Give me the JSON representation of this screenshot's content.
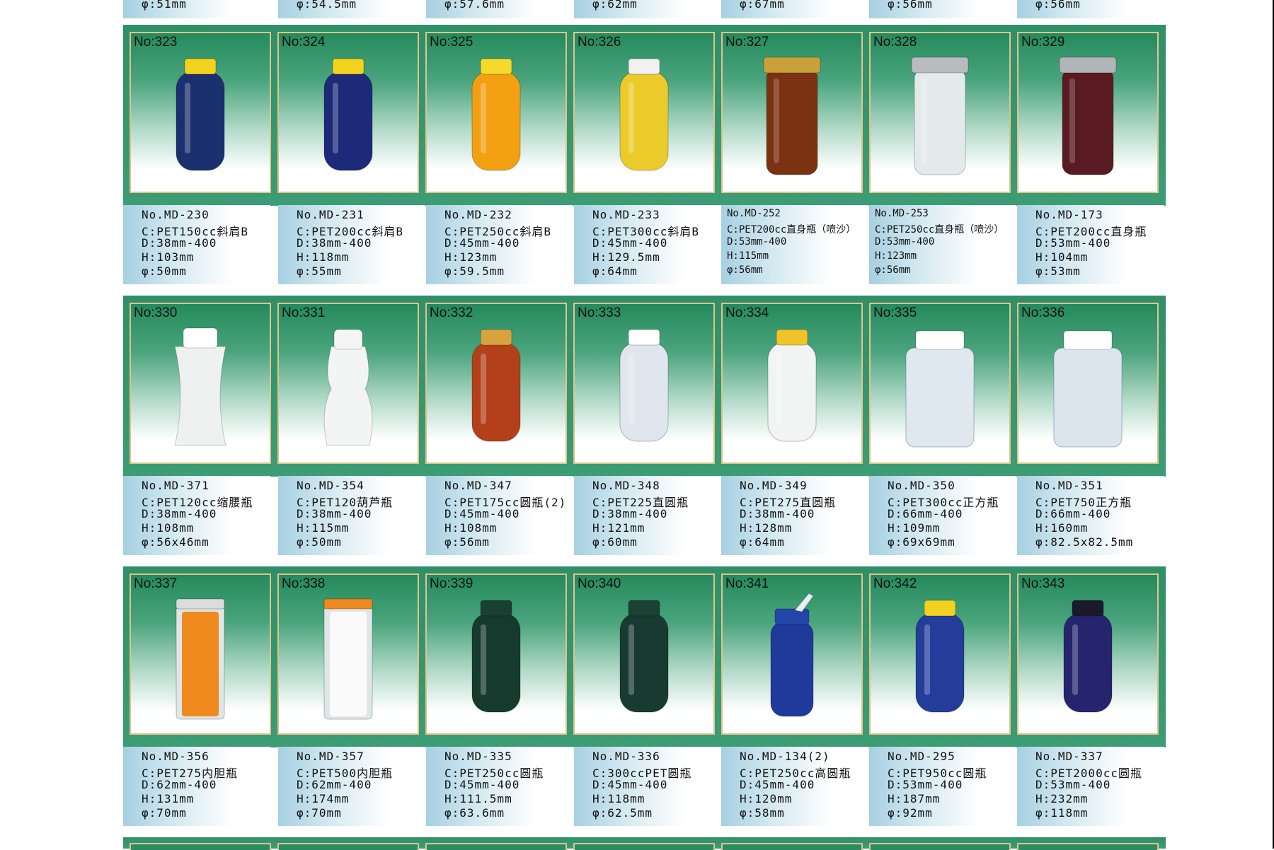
{
  "top_strip": [
    "φ:51mm",
    "φ:54.5mm",
    "φ:57.6mm",
    "φ:62mm",
    "φ:67mm",
    "φ:56mm",
    "φ:56mm"
  ],
  "rows": [
    [
      {
        "no": "No:323",
        "code": "No.MD-230",
        "c": "C:PET150cc斜肩B",
        "d": "D:38mm-400",
        "h": "H:103mm",
        "phi": "φ:50mm",
        "bottle": {
          "body": "#1c2f6e",
          "cap": "#f2d21e",
          "shape": "round"
        }
      },
      {
        "no": "No:324",
        "code": "No.MD-231",
        "c": "C:PET200cc斜肩B",
        "d": "D:38mm-400",
        "h": "H:118mm",
        "phi": "φ:55mm",
        "bottle": {
          "body": "#1d2a7a",
          "cap": "#f2d21e",
          "shape": "round"
        }
      },
      {
        "no": "No:325",
        "code": "No.MD-232",
        "c": "C:PET250cc斜肩B",
        "d": "D:45mm-400",
        "h": "H:123mm",
        "phi": "φ:59.5mm",
        "bottle": {
          "body": "#f2a012",
          "cap": "#f5d92c",
          "shape": "round"
        }
      },
      {
        "no": "No:326",
        "code": "No.MD-233",
        "c": "C:PET300cc斜肩B",
        "d": "D:45mm-400",
        "h": "H:129.5mm",
        "phi": "φ:64mm",
        "bottle": {
          "body": "#eacb2a",
          "cap": "#f1f1f1",
          "shape": "round"
        }
      },
      {
        "no": "No:327",
        "code": "No.MD-252",
        "c": "C:PET200cc直身瓶（喷沙）",
        "d": "D:53mm-400",
        "h": "H:115mm",
        "phi": "φ:56mm",
        "bottle": {
          "body": "#7a3212",
          "cap": "#c9a13a",
          "shape": "straight"
        }
      },
      {
        "no": "No:328",
        "code": "No.MD-253",
        "c": "C:PET250cc直身瓶（喷沙）",
        "d": "D:53mm-400",
        "h": "H:123mm",
        "phi": "φ:56mm",
        "bottle": {
          "body": "#e3ebea",
          "cap": "#b9bcbf",
          "shape": "straight"
        }
      },
      {
        "no": "No:329",
        "code": "No.MD-173",
        "c": "C:PET200cc直身瓶",
        "d": "D:53mm-400",
        "h": "H:104mm",
        "phi": "φ:53mm",
        "bottle": {
          "body": "#5a1a22",
          "cap": "#b1b5b8",
          "shape": "straight"
        }
      }
    ],
    [
      {
        "no": "No:330",
        "code": "No.MD-371",
        "c": "C:PET120cc缩腰瓶",
        "d": "D:38mm-400",
        "h": "H:108mm",
        "phi": "φ:56x46mm",
        "bottle": {
          "body": "#eef1f0",
          "cap": "#ffffff",
          "shape": "waist"
        }
      },
      {
        "no": "No:331",
        "code": "No.MD-354",
        "c": "C:PET120葫芦瓶",
        "d": "D:38mm-400",
        "h": "H:115mm",
        "phi": "φ:50mm",
        "bottle": {
          "body": "#f3f4f4",
          "cap": "#f5f5f5",
          "shape": "gourd"
        }
      },
      {
        "no": "No:332",
        "code": "No.MD-347",
        "c": "C:PET175cc圆瓶(2)",
        "d": "D:45mm-400",
        "h": "H:108mm",
        "phi": "φ:56mm",
        "bottle": {
          "body": "#b3401a",
          "cap": "#d6a33e",
          "shape": "round"
        }
      },
      {
        "no": "No:333",
        "code": "No.MD-348",
        "c": "C:PET225直圆瓶",
        "d": "D:38mm-400",
        "h": "H:121mm",
        "phi": "φ:60mm",
        "bottle": {
          "body": "#dfe6ee",
          "cap": "#ffffff",
          "shape": "round"
        }
      },
      {
        "no": "No:334",
        "code": "No.MD-349",
        "c": "C:PET275直圆瓶",
        "d": "D:38mm-400",
        "h": "H:128mm",
        "phi": "φ:64mm",
        "bottle": {
          "body": "#f2f3f3",
          "cap": "#f2c22a",
          "shape": "round"
        }
      },
      {
        "no": "No:335",
        "code": "No.MD-350",
        "c": "C:PET300cc正方瓶",
        "d": "D:66mm-400",
        "h": "H:109mm",
        "phi": "φ:69x69mm",
        "bottle": {
          "body": "#dfe7ef",
          "cap": "#ffffff",
          "shape": "square"
        }
      },
      {
        "no": "No:336",
        "code": "No.MD-351",
        "c": "C:PET750正方瓶",
        "d": "D:66mm-400",
        "h": "H:160mm",
        "phi": "φ:82.5x82.5mm",
        "bottle": {
          "body": "#dce5ee",
          "cap": "#ffffff",
          "shape": "square"
        }
      }
    ],
    [
      {
        "no": "No:337",
        "code": "No.MD-356",
        "c": "C:PET275内胆瓶",
        "d": "D:62mm-400",
        "h": "H:131mm",
        "phi": "φ:70mm",
        "bottle": {
          "body": "#f08a1e",
          "cap": "#dcdcdc",
          "shape": "inner"
        }
      },
      {
        "no": "No:338",
        "code": "No.MD-357",
        "c": "C:PET500内胆瓶",
        "d": "D:62mm-400",
        "h": "H:174mm",
        "phi": "φ:70mm",
        "bottle": {
          "body": "#fafafa",
          "cap": "#f08a1e",
          "shape": "inner"
        }
      },
      {
        "no": "No:339",
        "code": "No.MD-335",
        "c": "C:PET250cc圆瓶",
        "d": "D:45mm-400",
        "h": "H:111.5mm",
        "phi": "φ:63.6mm",
        "bottle": {
          "body": "#173a2e",
          "cap": "#1a3f33",
          "shape": "round"
        }
      },
      {
        "no": "No:340",
        "code": "No.MD-336",
        "c": "C:300ccPET圆瓶",
        "d": "D:45mm-400",
        "h": "H:118mm",
        "phi": "φ:62.5mm",
        "bottle": {
          "body": "#183a30",
          "cap": "#1b4034",
          "shape": "round"
        }
      },
      {
        "no": "No:341",
        "code": "No.MD-134(2)",
        "c": "C:PET250cc高圆瓶",
        "d": "D:45mm-400",
        "h": "H:120mm",
        "phi": "φ:58mm",
        "bottle": {
          "body": "#1f3a9a",
          "cap": "#2346a8",
          "shape": "flip"
        }
      },
      {
        "no": "No:342",
        "code": "No.MD-295",
        "c": "C:PET950cc圆瓶",
        "d": "D:53mm-400",
        "h": "H:187mm",
        "phi": "φ:92mm",
        "bottle": {
          "body": "#243c9a",
          "cap": "#f2d21e",
          "shape": "round"
        }
      },
      {
        "no": "No:343",
        "code": "No.MD-337",
        "c": "C:PET2000cc圆瓶",
        "d": "D:53mm-400",
        "h": "H:232mm",
        "phi": "φ:118mm",
        "bottle": {
          "body": "#27246e",
          "cap": "#1a1a2c",
          "shape": "round"
        }
      }
    ]
  ]
}
